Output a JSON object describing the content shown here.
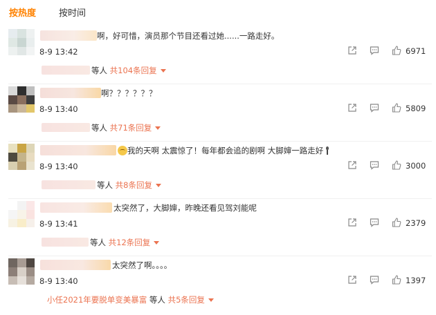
{
  "tabs": [
    {
      "label": "按热度",
      "active": true
    },
    {
      "label": "按时间",
      "active": false
    }
  ],
  "comments": [
    {
      "text": "啊，好可惜，演员那个节目还看过她......一路走好。",
      "time": "8-9 13:42",
      "likes": "6971",
      "reply_prefix": "等人",
      "reply_link": "共104条回复",
      "reply_name": ""
    },
    {
      "text": "啊？？？？？？",
      "time": "8-9 13:40",
      "likes": "5809",
      "reply_prefix": "等人",
      "reply_link": "共71条回复",
      "reply_name": ""
    },
    {
      "text": "我的天啊 太震惊了！每年都会追的剧啊 大脚婶一路走好",
      "time": "8-9 13:40",
      "likes": "3000",
      "reply_prefix": "等人",
      "reply_link": "共8条回复",
      "reply_name": ""
    },
    {
      "text": "太突然了，大脚婶，昨晚还看见驾刘能呢",
      "time": "8-9 13:41",
      "likes": "2379",
      "reply_prefix": "等人",
      "reply_link": "共12条回复",
      "reply_name": ""
    },
    {
      "text": "太突然了啊。。。。",
      "time": "8-9 13:40",
      "likes": "1397",
      "reply_prefix": "等人",
      "reply_link": "共5条回复",
      "reply_name": "小任2021年要脱单变美暴富"
    }
  ],
  "icons": {
    "share": "share-icon",
    "comment": "comment-icon",
    "like": "thumbs-up-icon"
  },
  "colors": {
    "accent": "#ff8200",
    "reply_link": "#eb7350"
  }
}
